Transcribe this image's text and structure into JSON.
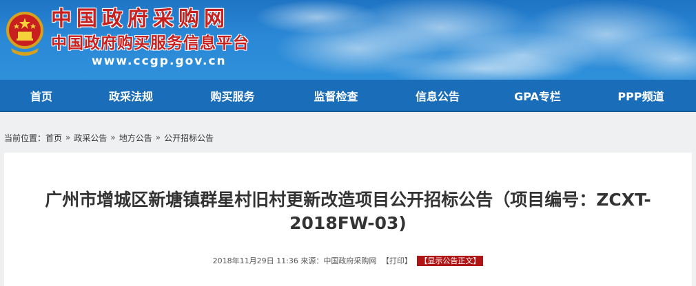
{
  "header": {
    "title": "中国政府采购网",
    "subtitle": "中国政府购买服务信息平台",
    "url": "www.ccgp.gov.cn",
    "emblem_icon": "national-emblem-icon",
    "colors": {
      "title_red": "#c8201e",
      "banner_blue": "#2a88d6",
      "nav_blue": "#1a6db8"
    }
  },
  "nav": {
    "items": [
      {
        "label": "首页"
      },
      {
        "label": "政采法规"
      },
      {
        "label": "购买服务"
      },
      {
        "label": "监督检查"
      },
      {
        "label": "信息公告"
      },
      {
        "label": "GPA专栏"
      },
      {
        "label": "PPP频道"
      }
    ]
  },
  "breadcrumb": {
    "prefix": "当前位置：",
    "items": [
      {
        "label": "首页"
      },
      {
        "label": "政采公告"
      },
      {
        "label": "地方公告"
      },
      {
        "label": "公开招标公告"
      }
    ],
    "separator": "»"
  },
  "article": {
    "title": "广州市增城区新塘镇群星村旧村更新改造项目公开招标公告（项目编号：ZCXT-2018FW-03)",
    "date": "2018年11月29日 11:36",
    "source_label": "来源：",
    "source": "中国政府采购网",
    "print_label": "【打印】",
    "show_label": "【显示公告正文】",
    "show_color": "#b01515"
  }
}
